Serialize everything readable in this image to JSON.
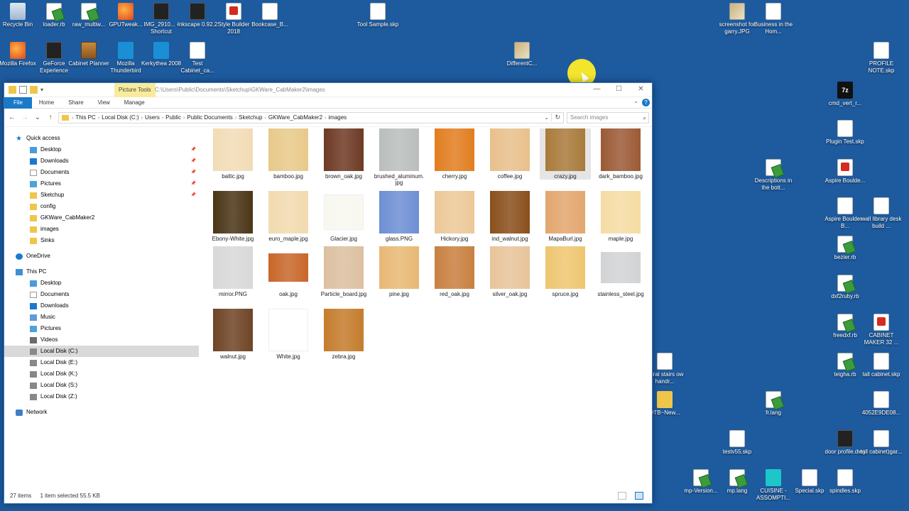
{
  "desktop": {
    "icons": [
      {
        "label": "Recycle Bin",
        "icon": "recycle-bin-icon"
      },
      {
        "label": "loader.rb",
        "icon": "ruby-file-icon"
      },
      {
        "label": "raw_multiw...",
        "icon": "ruby-file-icon"
      },
      {
        "label": "GPUTweak...",
        "icon": "app-icon"
      },
      {
        "label": "IMG_2910... - Shortcut",
        "icon": "shortcut-icon"
      },
      {
        "label": "Inkscape 0.92.2",
        "icon": "inkscape-icon"
      },
      {
        "label": "Style Builder 2018",
        "icon": "style-builder-icon"
      },
      {
        "label": "Bookcase_B...",
        "icon": "file-icon"
      },
      {
        "label": "Tool Sample.skp",
        "icon": "skp-file-icon"
      },
      {
        "label": "screenshot for garry.JPG",
        "icon": "image-file-icon"
      },
      {
        "label": "Business in the Hom...",
        "icon": "document-icon"
      },
      {
        "label": "Mozilla Firefox",
        "icon": "firefox-icon"
      },
      {
        "label": "GeForce Experience",
        "icon": "geforce-icon"
      },
      {
        "label": "Cabinet Planner",
        "icon": "cabinet-planner-icon"
      },
      {
        "label": "Mozilla Thunderbird",
        "icon": "thunderbird-icon"
      },
      {
        "label": "Kerkythea 2008",
        "icon": "kerkythea-icon"
      },
      {
        "label": "Test Cabinet_ca...",
        "icon": "document-icon"
      },
      {
        "label": "DifferentC...",
        "icon": "image-file-icon"
      },
      {
        "label": "PROFILE NOTE.skp",
        "icon": "skp-file-icon"
      },
      {
        "label": "cmd_vert_r...",
        "icon": "7zip-icon"
      },
      {
        "label": "Plugin Test.skp",
        "icon": "skp-file-icon"
      },
      {
        "label": "Descriptions in the bott...",
        "icon": "ruby-file-icon"
      },
      {
        "label": "Aspire Boulde...",
        "icon": "pdf-icon"
      },
      {
        "label": "Aspire Boulder - B...",
        "icon": "file-icon"
      },
      {
        "label": "wall library desk build ...",
        "icon": "skp-file-icon"
      },
      {
        "label": "bezier.rb",
        "icon": "ruby-file-icon"
      },
      {
        "label": "dxf2ruby.rb",
        "icon": "ruby-file-icon"
      },
      {
        "label": "freedxf.rb",
        "icon": "ruby-file-icon"
      },
      {
        "label": "CABINET MAKER 32 ...",
        "icon": "pdf-icon"
      },
      {
        "label": "spiral stairs ow handr...",
        "icon": "skp-file-icon"
      },
      {
        "label": "teigha.rb",
        "icon": "ruby-file-icon"
      },
      {
        "label": "tall cabinet.skp",
        "icon": "skp-file-icon"
      },
      {
        "label": "DTB~New...",
        "icon": "zip-folder-icon"
      },
      {
        "label": "fr.lang",
        "icon": "ruby-file-icon"
      },
      {
        "label": "4052E9DE08...",
        "icon": "file-icon"
      },
      {
        "label": "testv55.skp",
        "icon": "skp-file-icon"
      },
      {
        "label": "door profile.dwg",
        "icon": "dwg-file-icon"
      },
      {
        "label": "tall cabinet)gar...",
        "icon": "skp-file-icon"
      },
      {
        "label": "mp-Version...",
        "icon": "ruby-file-icon"
      },
      {
        "label": "mp.lang",
        "icon": "ruby-file-icon"
      },
      {
        "label": "CUISINE -ASSOMPTI...",
        "icon": "teal-app-icon"
      },
      {
        "label": "Special.skp",
        "icon": "skp-file-icon"
      },
      {
        "label": "spindles.skp",
        "icon": "skp-file-icon"
      }
    ]
  },
  "window": {
    "contextual_tab": "Picture Tools",
    "title_path": "C:\\Users\\Public\\Documents\\Sketchup\\GKWare_CabMaker2\\images",
    "controls": {
      "minimize": "—",
      "maximize": "☐",
      "close": "✕"
    },
    "ribbon_tabs": [
      "File",
      "Home",
      "Share",
      "View",
      "Manage"
    ],
    "help": "?",
    "address": {
      "crumbs": [
        "This PC",
        "Local Disk (C:)",
        "Users",
        "Public",
        "Public Documents",
        "Sketchup",
        "GKWare_CabMaker2",
        "images"
      ]
    },
    "search_placeholder": "Search images",
    "nav": {
      "quick_access": "Quick access",
      "quick_items": [
        "Desktop",
        "Downloads",
        "Documents",
        "Pictures",
        "Sketchup",
        "config",
        "GKWare_CabMaker2",
        "images",
        "Sinks"
      ],
      "onedrive": "OneDrive",
      "this_pc": "This PC",
      "pc_items": [
        "Desktop",
        "Documents",
        "Downloads",
        "Music",
        "Pictures",
        "Videos",
        "Local Disk (C:)",
        "Local Disk (E:)",
        "Local Disk (K:)",
        "Local Disk (S:)",
        "Local Disk (Z:)"
      ],
      "network": "Network"
    },
    "files": [
      {
        "name": "baltic.jpg",
        "color": "#f2dcb6"
      },
      {
        "name": "bamboo.jpg",
        "color": "#e8c98a"
      },
      {
        "name": "brown_oak.jpg",
        "color": "#6e3a24"
      },
      {
        "name": "brushed_aluminum.jpg",
        "color": "#b9bebd"
      },
      {
        "name": "cherry.jpg",
        "color": "#e27d1f"
      },
      {
        "name": "coffee.jpg",
        "color": "#e8c08c"
      },
      {
        "name": "crazy.jpg",
        "color": "#a97a3a"
      },
      {
        "name": "dark_bamboo.jpg",
        "color": "#9c5a36"
      },
      {
        "name": "Ebony-White.jpg",
        "color": "#4a3516"
      },
      {
        "name": "euro_maple.jpg",
        "color": "#f2dab0"
      },
      {
        "name": "Glacier.jpg",
        "color": "#f8f8f0"
      },
      {
        "name": "glass.PNG",
        "color": "#6e8fd4"
      },
      {
        "name": "Hickory.jpg",
        "color": "#ecc898"
      },
      {
        "name": "ind_walnut.jpg",
        "color": "#8a4f1c"
      },
      {
        "name": "MapaBurl.jpg",
        "color": "#e3a66e"
      },
      {
        "name": "maple.jpg",
        "color": "#f6dca4"
      },
      {
        "name": "mirror.PNG",
        "color": "#d8d8d8"
      },
      {
        "name": "oak.jpg",
        "color": "#c8672a"
      },
      {
        "name": "Particle_board.jpg",
        "color": "#dcc0a0"
      },
      {
        "name": "pine.jpg",
        "color": "#e8b874"
      },
      {
        "name": "red_oak.jpg",
        "color": "#c8803f"
      },
      {
        "name": "silver_oak.jpg",
        "color": "#e8c49a"
      },
      {
        "name": "spruce.jpg",
        "color": "#eec670"
      },
      {
        "name": "stainless_steel.jpg",
        "color": "#d2d3d5"
      },
      {
        "name": "walnut.jpg",
        "color": "#6e4425"
      },
      {
        "name": "White.jpg",
        "color": "#ffffff"
      },
      {
        "name": "zebra.jpg",
        "color": "#c47c2c"
      }
    ],
    "selected_file": "crazy.jpg",
    "status": {
      "count": "27 items",
      "selection": "1 item selected  55.5 KB"
    }
  }
}
